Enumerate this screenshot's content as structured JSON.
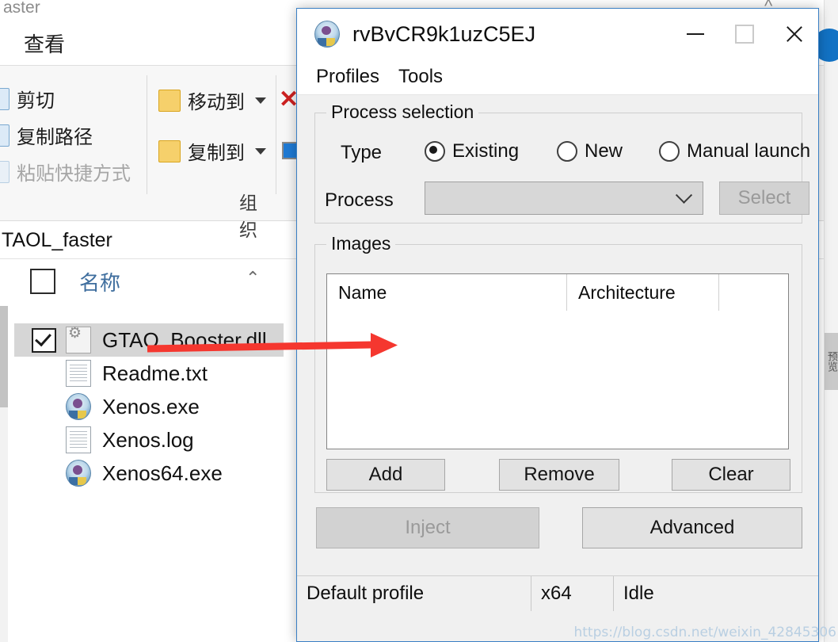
{
  "explorer": {
    "window_title_fragment": "aster",
    "tab_label": "查看",
    "ribbon": {
      "clipboard_items": [
        {
          "label": "剪切",
          "icon": "scissors-icon",
          "enabled": true
        },
        {
          "label": "复制路径",
          "icon": "copy-path-icon",
          "enabled": true
        },
        {
          "label": "粘贴快捷方式",
          "icon": "paste-shortcut-icon",
          "enabled": false
        }
      ],
      "organize_items": [
        {
          "label": "移动到",
          "icon": "move-to-icon",
          "has_dropdown": true
        },
        {
          "label": "复制到",
          "icon": "copy-to-icon",
          "has_dropdown": true
        }
      ],
      "organize_group_label": "组织",
      "delete_icon": "delete-x-icon",
      "rename_icon": "rename-icon"
    },
    "breadcrumb": "TAOL_faster",
    "list_header": {
      "select_all_label": "",
      "name_column": "名称",
      "sort_indicator": "⌃"
    },
    "files": [
      {
        "name": "GTAO_Booster.dll",
        "icon": "dll-file-icon",
        "checked": true,
        "selected": true
      },
      {
        "name": "Readme.txt",
        "icon": "text-file-icon",
        "checked": false,
        "selected": false
      },
      {
        "name": "Xenos.exe",
        "icon": "xenos-app-icon",
        "checked": false,
        "selected": false
      },
      {
        "name": "Xenos.log",
        "icon": "text-file-icon",
        "checked": false,
        "selected": false
      },
      {
        "name": "Xenos64.exe",
        "icon": "xenos-app-icon",
        "checked": false,
        "selected": false
      }
    ],
    "side_panel_label": "预览",
    "close_glyph": "✕"
  },
  "dialog": {
    "title": "rvBvCR9k1uzC5EJ",
    "app_icon": "xenos-app-icon",
    "window_buttons": {
      "minimize": "minimize-icon",
      "maximize": "maximize-icon",
      "close": "close-icon"
    },
    "menu": [
      {
        "label": "Profiles"
      },
      {
        "label": "Tools"
      }
    ],
    "process_selection": {
      "legend": "Process selection",
      "type_label": "Type",
      "radios": [
        {
          "label": "Existing",
          "checked": true
        },
        {
          "label": "New",
          "checked": false
        },
        {
          "label": "Manual launch",
          "checked": false
        }
      ],
      "process_label": "Process",
      "process_value": "",
      "process_placeholder": "",
      "select_button": "Select",
      "select_enabled": false
    },
    "images": {
      "legend": "Images",
      "columns": [
        "Name",
        "Architecture",
        ""
      ],
      "rows": [],
      "buttons": [
        {
          "label": "Add",
          "enabled": true
        },
        {
          "label": "Remove",
          "enabled": true
        },
        {
          "label": "Clear",
          "enabled": true
        }
      ]
    },
    "actions": [
      {
        "label": "Inject",
        "enabled": false
      },
      {
        "label": "Advanced",
        "enabled": true
      }
    ],
    "statusbar": {
      "profile": "Default profile",
      "architecture": "x64",
      "state": "Idle"
    }
  },
  "annotations": {
    "arrow_color": "#f5372f",
    "arrow_label": "red-arrow-from-dll-to-images-list",
    "watermark": "https://blog.csdn.net/weixin_42845306"
  }
}
